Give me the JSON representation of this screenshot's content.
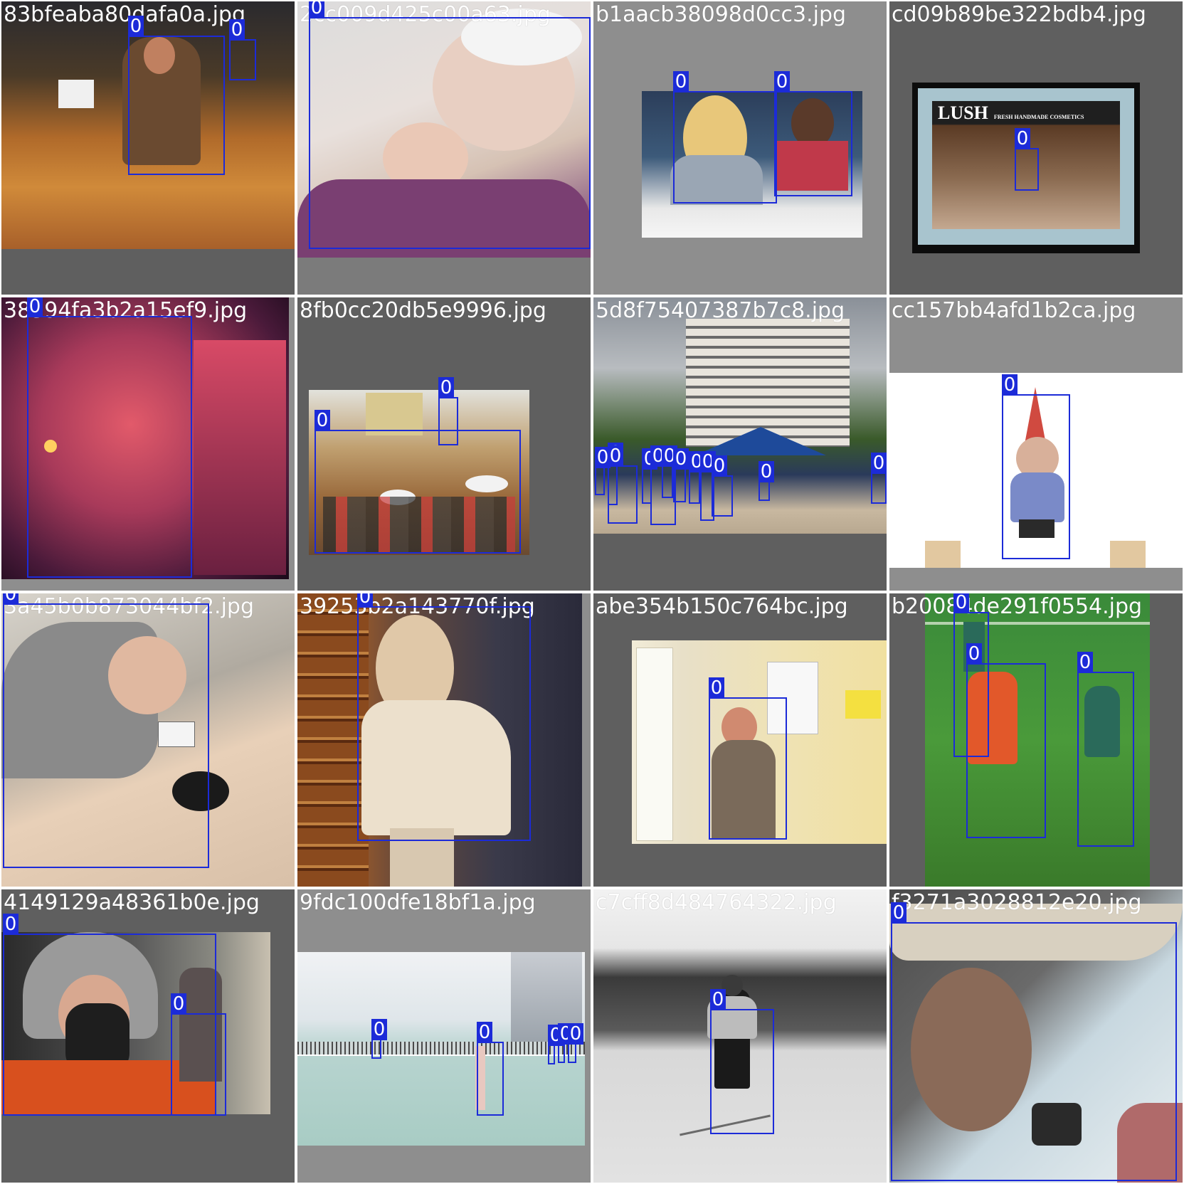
{
  "colors": {
    "box": "#1c2bd8",
    "label_text": "#ffffff"
  },
  "class_label": "0",
  "cells": [
    {
      "file": "83bfeaba80dafa0a.jpg"
    },
    {
      "file": "2cc009d425c00a63.jpg"
    },
    {
      "file": "b1aacb38098d0cc3.jpg"
    },
    {
      "file": "cd09b89be322bdb4.jpg",
      "sign_text": "LUSH",
      "sign_sub": "FRESH HANDMADE COSMETICS"
    },
    {
      "file": "38394fa3b2a15ef9.jpg"
    },
    {
      "file": "8fb0cc20db5e9996.jpg"
    },
    {
      "file": "5d8f75407387b7c8.jpg"
    },
    {
      "file": "cc157bb4afd1b2ca.jpg"
    },
    {
      "file": "3a45b0b873044bf2.jpg"
    },
    {
      "file": "39253b2a143770f.jpg"
    },
    {
      "file": "abe354b150c764bc.jpg"
    },
    {
      "file": "b20084de291f0554.jpg"
    },
    {
      "file": "4149129a48361b0e.jpg"
    },
    {
      "file": "9fdc100dfe18bf1a.jpg"
    },
    {
      "file": "c7cff8d484764322.jpg"
    },
    {
      "file": "f3271a3028812e20.jpg"
    }
  ]
}
